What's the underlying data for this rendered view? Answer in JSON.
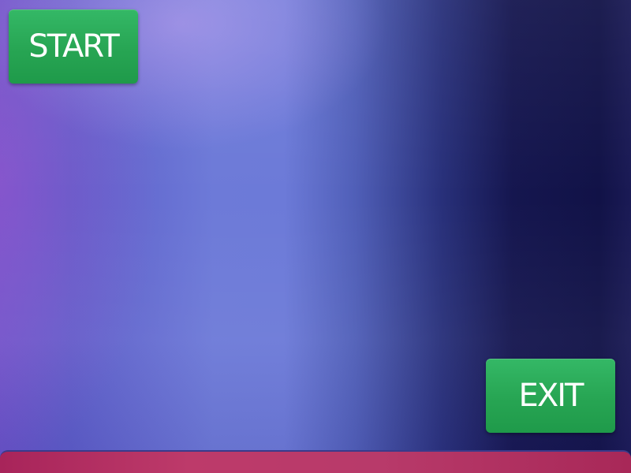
{
  "screen": {
    "start_button": {
      "label": "START"
    },
    "exit_button": {
      "label": "EXIT"
    }
  },
  "colors": {
    "button_green": "#27a553",
    "bar_crimson": "#b83a6a",
    "background_light": "#6c7ad8",
    "background_dark": "#111247"
  },
  "icons": []
}
